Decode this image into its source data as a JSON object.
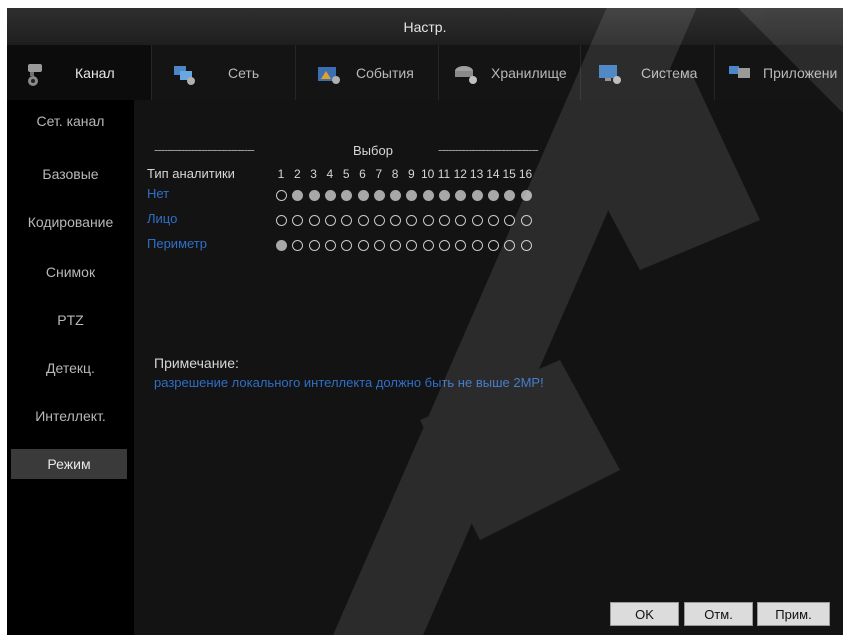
{
  "window": {
    "title": "Настр."
  },
  "tabs": [
    {
      "label": "Канал",
      "icon": "camera-icon"
    },
    {
      "label": "Сеть",
      "icon": "network-icon"
    },
    {
      "label": "События",
      "icon": "events-icon"
    },
    {
      "label": "Хранилище",
      "icon": "storage-icon"
    },
    {
      "label": "Система",
      "icon": "system-icon"
    },
    {
      "label": "Приложени",
      "icon": "apps-icon"
    }
  ],
  "sidebar": {
    "items": [
      {
        "label": "Сет. канал"
      },
      {
        "label": "Базовые"
      },
      {
        "label": "Кодирование"
      },
      {
        "label": "Снимок"
      },
      {
        "label": "PTZ"
      },
      {
        "label": "Детекц."
      },
      {
        "label": "Интеллект."
      },
      {
        "label": "Режим"
      }
    ],
    "active_index": 7
  },
  "mode": {
    "dash_left": "------------------------------",
    "select_label": "Выбор",
    "dash_right": "------------------------------",
    "type_label": "Тип аналитики",
    "channels": [
      "1",
      "2",
      "3",
      "4",
      "5",
      "6",
      "7",
      "8",
      "9",
      "10",
      "11",
      "12",
      "13",
      "14",
      "15",
      "16"
    ],
    "rows": [
      {
        "label": "Нет",
        "selected": [
          false,
          true,
          true,
          true,
          true,
          true,
          true,
          true,
          true,
          true,
          true,
          true,
          true,
          true,
          true,
          true
        ]
      },
      {
        "label": "Лицо",
        "selected": [
          false,
          false,
          false,
          false,
          false,
          false,
          false,
          false,
          false,
          false,
          false,
          false,
          false,
          false,
          false,
          false
        ]
      },
      {
        "label": "Периметр",
        "selected": [
          true,
          false,
          false,
          false,
          false,
          false,
          false,
          false,
          false,
          false,
          false,
          false,
          false,
          false,
          false,
          false
        ]
      }
    ],
    "note_label": "Примечание:",
    "note_text": "разрешение локального интеллекта должно быть не выше 2MP!"
  },
  "buttons": {
    "ok": "OK",
    "cancel": "Отм.",
    "apply": "Прим."
  },
  "colors": {
    "accent_blue": "#2f6fc7",
    "background": "#131313"
  }
}
